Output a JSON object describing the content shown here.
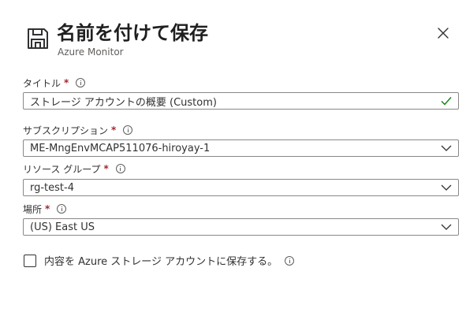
{
  "header": {
    "title": "名前を付けて保存",
    "subtitle": "Azure Monitor",
    "icon": "save-icon",
    "close_icon": "close-icon"
  },
  "form": {
    "title_field": {
      "label": "タイトル",
      "required_mark": "*",
      "value": "ストレージ アカウントの概要 (Custom)",
      "status_icon": "checkmark-icon",
      "status_color": "#107c10"
    },
    "subscription_field": {
      "label": "サブスクリプション",
      "required_mark": "*",
      "value": "ME-MngEnvMCAP511076-hiroyay-1"
    },
    "resource_group_field": {
      "label": "リソース グループ",
      "required_mark": "*",
      "value": "rg-test-4"
    },
    "location_field": {
      "label": "場所",
      "required_mark": "*",
      "value": "(US) East US"
    },
    "save_content_checkbox": {
      "label": "内容を Azure ストレージ アカウントに保存する。",
      "checked": false
    }
  },
  "colors": {
    "required": "#a4262c",
    "border": "#8a8886",
    "text": "#323130"
  }
}
